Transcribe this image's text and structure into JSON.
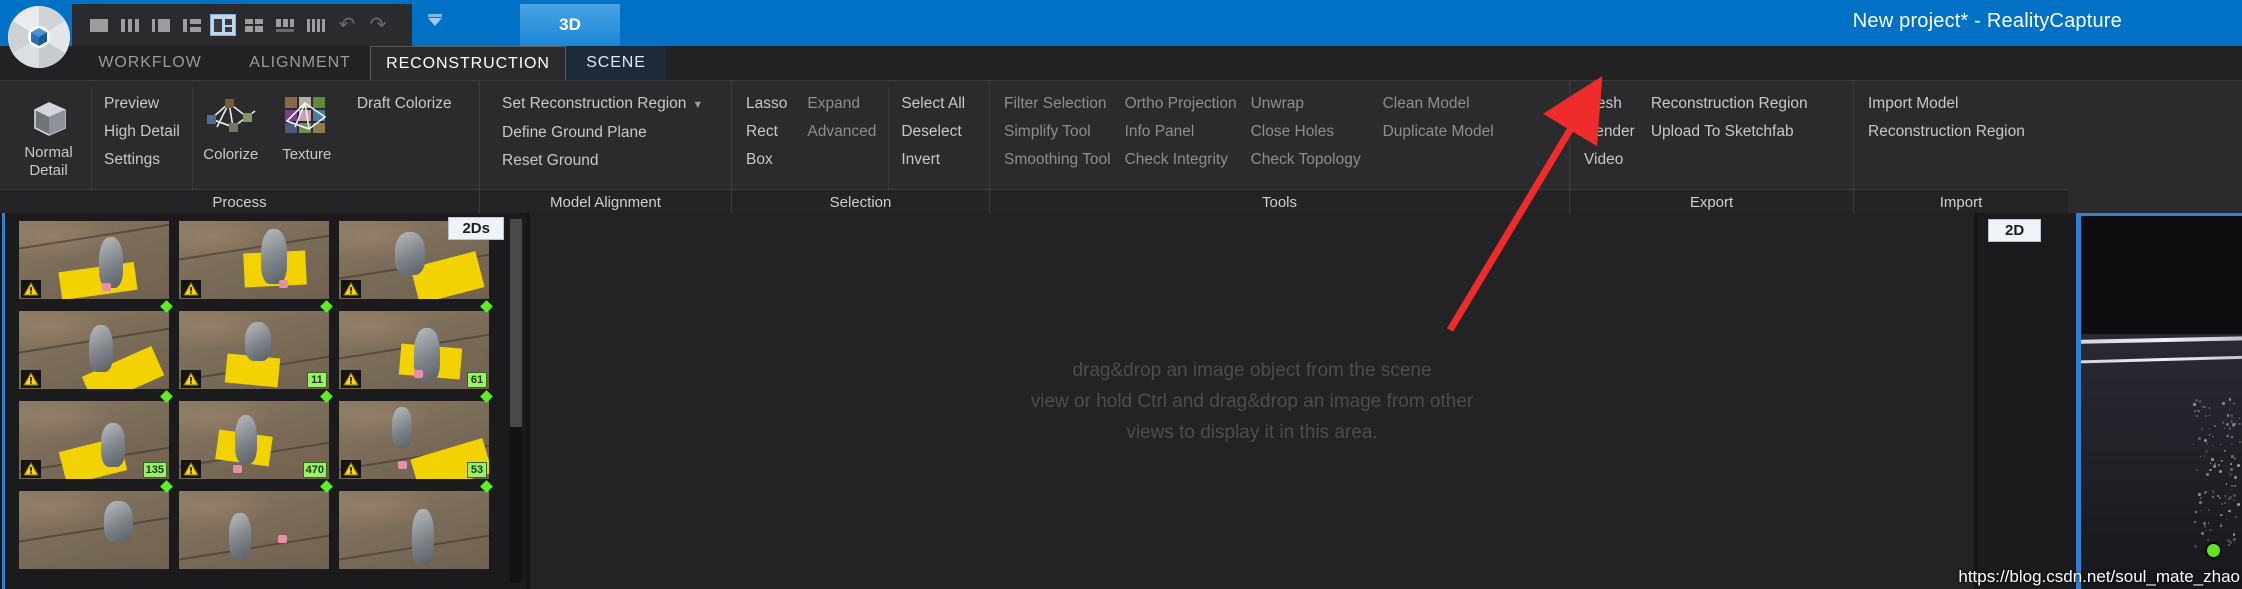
{
  "window": {
    "title": "New project* - RealityCapture",
    "logo_icon": "realitycapture-aperture-logo"
  },
  "quick_toolbar": {
    "items": [
      {
        "name": "layout-single",
        "selected": false
      },
      {
        "name": "layout-three-columns",
        "selected": false
      },
      {
        "name": "layout-two-uneven",
        "selected": false
      },
      {
        "name": "layout-one-plus-two-rows",
        "selected": false
      },
      {
        "name": "layout-one-plus-two",
        "selected": true
      },
      {
        "name": "layout-quad",
        "selected": false
      },
      {
        "name": "layout-wide-bottom",
        "selected": false
      },
      {
        "name": "layout-grid-many",
        "selected": false
      }
    ],
    "undo_label": "Undo",
    "redo_label": "Redo",
    "collapse_label": "Collapse ribbon"
  },
  "view_tab": {
    "label": "3D"
  },
  "ribbon_tabs": [
    {
      "label": "WORKFLOW",
      "active": false
    },
    {
      "label": "ALIGNMENT",
      "active": false
    },
    {
      "label": "RECONSTRUCTION",
      "active": true
    },
    {
      "label": "SCENE",
      "active": false
    }
  ],
  "ribbon_groups": [
    {
      "title": "Process",
      "big_button": {
        "label_line1": "Normal",
        "label_line2": "Detail",
        "icon": "cube-icon"
      },
      "list": [
        "Preview",
        "High Detail",
        "Settings"
      ],
      "medium_buttons": [
        {
          "label": "Colorize",
          "icon": "colorize-mesh-icon"
        },
        {
          "label": "Texture",
          "icon": "texture-mesh-icon"
        }
      ],
      "extra": [
        "Draft Colorize"
      ]
    },
    {
      "title": "Model Alignment",
      "list": [
        "Set Reconstruction Region",
        "Define Ground Plane",
        "Reset Ground"
      ],
      "dropdown_on_first": true
    },
    {
      "title": "Selection",
      "col1": [
        "Lasso",
        "Rect",
        "Box"
      ],
      "col2": [
        "Expand",
        "Advanced"
      ],
      "col3": [
        "Select All",
        "Deselect",
        "Invert"
      ]
    },
    {
      "title": "Tools",
      "col1": [
        "Filter Selection",
        "Simplify Tool",
        "Smoothing Tool"
      ],
      "col2": [
        "Ortho Projection",
        "Info Panel",
        "Check Integrity"
      ],
      "col3": [
        "Unwrap",
        "Close Holes",
        "Check Topology"
      ],
      "col4": [
        "Clean Model",
        "Duplicate Model"
      ]
    },
    {
      "title": "Export",
      "col1": [
        "Mesh",
        "Render",
        "Video"
      ],
      "col2": [
        "Reconstruction Region",
        "Upload To Sketchfab"
      ]
    },
    {
      "title": "Import",
      "col1": [
        "Import Model",
        "Reconstruction Region"
      ]
    }
  ],
  "left_panel": {
    "view_tag": "2Ds",
    "thumbnails": [
      {
        "badge": "",
        "warn": true,
        "aligned": false
      },
      {
        "badge": "",
        "warn": true,
        "aligned": false
      },
      {
        "badge": "",
        "warn": true,
        "aligned": false
      },
      {
        "badge": "",
        "warn": true,
        "aligned": true
      },
      {
        "badge": "11",
        "warn": true,
        "aligned": true
      },
      {
        "badge": "61",
        "warn": true,
        "aligned": true
      },
      {
        "badge": "135",
        "warn": true,
        "aligned": true
      },
      {
        "badge": "470",
        "warn": true,
        "aligned": true
      },
      {
        "badge": "53",
        "warn": true,
        "aligned": true
      },
      {
        "badge": "",
        "warn": false,
        "aligned": true
      },
      {
        "badge": "",
        "warn": false,
        "aligned": true
      },
      {
        "badge": "",
        "warn": false,
        "aligned": true
      }
    ]
  },
  "center_panel": {
    "hint_line1": "drag&drop an image object from the scene",
    "hint_line2": "view or hold Ctrl and drag&drop an image from other",
    "hint_line3": "views to display it in this area."
  },
  "right_panel": {
    "view_tag": "2D"
  },
  "watermark": {
    "text": "https://blog.csdn.net/soul_mate_zhao"
  },
  "annotation": {
    "arrow_color": "#ef2b2b",
    "points_to": "Mesh"
  },
  "colors": {
    "title_bar": "#0071c5",
    "ribbon_bg": "#2b2b2d",
    "accent_blue": "#2f80d2",
    "badge_green": "#9bf06a"
  }
}
